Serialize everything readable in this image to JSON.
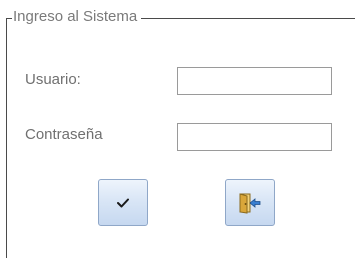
{
  "login_group": {
    "caption": "Ingreso al Sistema"
  },
  "fields": {
    "user_label": "Usuario:",
    "user_value": "",
    "password_label": "Contraseña",
    "password_value": ""
  },
  "buttons": {
    "accept_icon": "checkmark-icon",
    "exit_icon": "exit-door-icon"
  },
  "colors": {
    "button_gradient_top": "#eef4fc",
    "button_gradient_bottom": "#c6d8f0",
    "button_border": "#8fa7c8",
    "exit_arrow": "#3a7fd0",
    "door": "#d9a63a"
  }
}
